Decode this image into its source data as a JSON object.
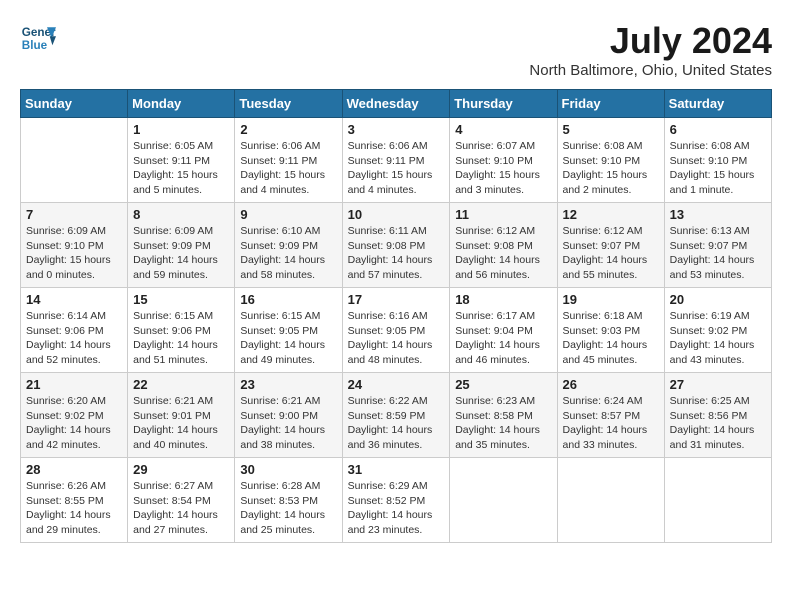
{
  "header": {
    "logo_line1": "General",
    "logo_line2": "Blue",
    "month_year": "July 2024",
    "location": "North Baltimore, Ohio, United States"
  },
  "days_of_week": [
    "Sunday",
    "Monday",
    "Tuesday",
    "Wednesday",
    "Thursday",
    "Friday",
    "Saturday"
  ],
  "weeks": [
    [
      {
        "day": "",
        "text": ""
      },
      {
        "day": "1",
        "text": "Sunrise: 6:05 AM\nSunset: 9:11 PM\nDaylight: 15 hours\nand 5 minutes."
      },
      {
        "day": "2",
        "text": "Sunrise: 6:06 AM\nSunset: 9:11 PM\nDaylight: 15 hours\nand 4 minutes."
      },
      {
        "day": "3",
        "text": "Sunrise: 6:06 AM\nSunset: 9:11 PM\nDaylight: 15 hours\nand 4 minutes."
      },
      {
        "day": "4",
        "text": "Sunrise: 6:07 AM\nSunset: 9:10 PM\nDaylight: 15 hours\nand 3 minutes."
      },
      {
        "day": "5",
        "text": "Sunrise: 6:08 AM\nSunset: 9:10 PM\nDaylight: 15 hours\nand 2 minutes."
      },
      {
        "day": "6",
        "text": "Sunrise: 6:08 AM\nSunset: 9:10 PM\nDaylight: 15 hours\nand 1 minute."
      }
    ],
    [
      {
        "day": "7",
        "text": "Sunrise: 6:09 AM\nSunset: 9:10 PM\nDaylight: 15 hours\nand 0 minutes."
      },
      {
        "day": "8",
        "text": "Sunrise: 6:09 AM\nSunset: 9:09 PM\nDaylight: 14 hours\nand 59 minutes."
      },
      {
        "day": "9",
        "text": "Sunrise: 6:10 AM\nSunset: 9:09 PM\nDaylight: 14 hours\nand 58 minutes."
      },
      {
        "day": "10",
        "text": "Sunrise: 6:11 AM\nSunset: 9:08 PM\nDaylight: 14 hours\nand 57 minutes."
      },
      {
        "day": "11",
        "text": "Sunrise: 6:12 AM\nSunset: 9:08 PM\nDaylight: 14 hours\nand 56 minutes."
      },
      {
        "day": "12",
        "text": "Sunrise: 6:12 AM\nSunset: 9:07 PM\nDaylight: 14 hours\nand 55 minutes."
      },
      {
        "day": "13",
        "text": "Sunrise: 6:13 AM\nSunset: 9:07 PM\nDaylight: 14 hours\nand 53 minutes."
      }
    ],
    [
      {
        "day": "14",
        "text": "Sunrise: 6:14 AM\nSunset: 9:06 PM\nDaylight: 14 hours\nand 52 minutes."
      },
      {
        "day": "15",
        "text": "Sunrise: 6:15 AM\nSunset: 9:06 PM\nDaylight: 14 hours\nand 51 minutes."
      },
      {
        "day": "16",
        "text": "Sunrise: 6:15 AM\nSunset: 9:05 PM\nDaylight: 14 hours\nand 49 minutes."
      },
      {
        "day": "17",
        "text": "Sunrise: 6:16 AM\nSunset: 9:05 PM\nDaylight: 14 hours\nand 48 minutes."
      },
      {
        "day": "18",
        "text": "Sunrise: 6:17 AM\nSunset: 9:04 PM\nDaylight: 14 hours\nand 46 minutes."
      },
      {
        "day": "19",
        "text": "Sunrise: 6:18 AM\nSunset: 9:03 PM\nDaylight: 14 hours\nand 45 minutes."
      },
      {
        "day": "20",
        "text": "Sunrise: 6:19 AM\nSunset: 9:02 PM\nDaylight: 14 hours\nand 43 minutes."
      }
    ],
    [
      {
        "day": "21",
        "text": "Sunrise: 6:20 AM\nSunset: 9:02 PM\nDaylight: 14 hours\nand 42 minutes."
      },
      {
        "day": "22",
        "text": "Sunrise: 6:21 AM\nSunset: 9:01 PM\nDaylight: 14 hours\nand 40 minutes."
      },
      {
        "day": "23",
        "text": "Sunrise: 6:21 AM\nSunset: 9:00 PM\nDaylight: 14 hours\nand 38 minutes."
      },
      {
        "day": "24",
        "text": "Sunrise: 6:22 AM\nSunset: 8:59 PM\nDaylight: 14 hours\nand 36 minutes."
      },
      {
        "day": "25",
        "text": "Sunrise: 6:23 AM\nSunset: 8:58 PM\nDaylight: 14 hours\nand 35 minutes."
      },
      {
        "day": "26",
        "text": "Sunrise: 6:24 AM\nSunset: 8:57 PM\nDaylight: 14 hours\nand 33 minutes."
      },
      {
        "day": "27",
        "text": "Sunrise: 6:25 AM\nSunset: 8:56 PM\nDaylight: 14 hours\nand 31 minutes."
      }
    ],
    [
      {
        "day": "28",
        "text": "Sunrise: 6:26 AM\nSunset: 8:55 PM\nDaylight: 14 hours\nand 29 minutes."
      },
      {
        "day": "29",
        "text": "Sunrise: 6:27 AM\nSunset: 8:54 PM\nDaylight: 14 hours\nand 27 minutes."
      },
      {
        "day": "30",
        "text": "Sunrise: 6:28 AM\nSunset: 8:53 PM\nDaylight: 14 hours\nand 25 minutes."
      },
      {
        "day": "31",
        "text": "Sunrise: 6:29 AM\nSunset: 8:52 PM\nDaylight: 14 hours\nand 23 minutes."
      },
      {
        "day": "",
        "text": ""
      },
      {
        "day": "",
        "text": ""
      },
      {
        "day": "",
        "text": ""
      }
    ]
  ]
}
